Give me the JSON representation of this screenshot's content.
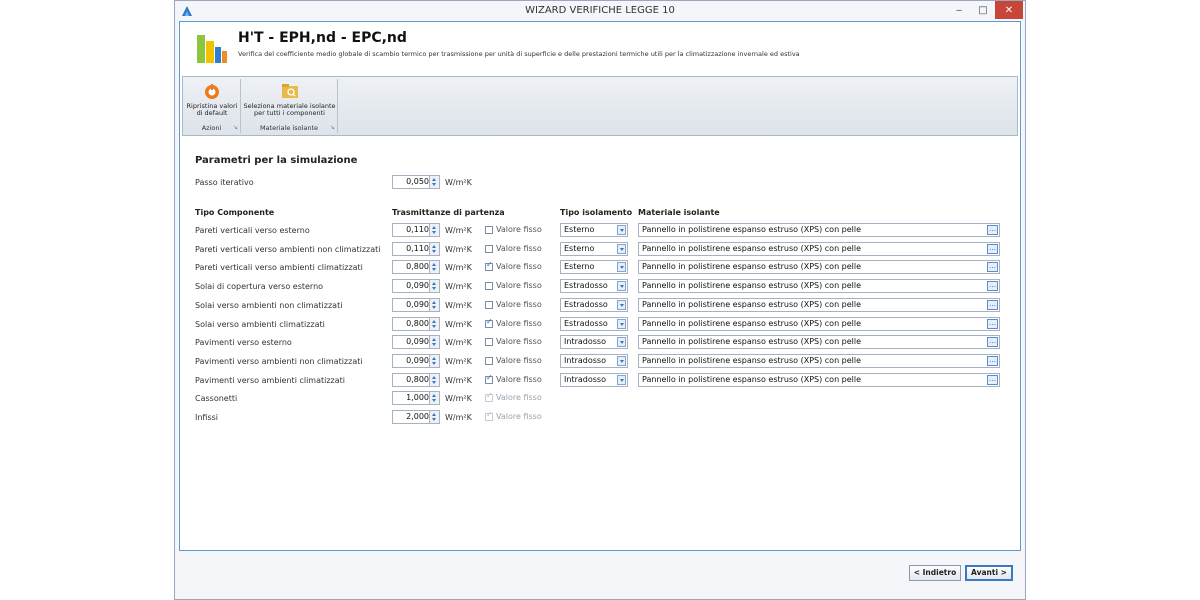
{
  "window": {
    "title": "WIZARD VERIFICHE LEGGE 10",
    "minimize": "‒",
    "maximize": "□",
    "close": "✕"
  },
  "header": {
    "title": "H'T - EPH,nd - EPC,nd",
    "subtitle": "Verifica del coefficiente medio globale di scambio termico per trasmissione per unità di superficie e delle prestazioni termiche utili per la climatizzazione invernale ed estiva"
  },
  "ribbon": {
    "groups": [
      {
        "label": "Azioni",
        "button_line1": "Ripristina valori",
        "button_line2": "di default",
        "icon": "reset-icon"
      },
      {
        "label": "Materiale isolante",
        "button_line1": "Seleziona materiale isolante",
        "button_line2": "per tutti i componenti",
        "icon": "folder-search-icon"
      }
    ]
  },
  "params": {
    "section_title": "Parametri per la simulazione",
    "step_label": "Passo iterativo",
    "step_value": "0,050",
    "unit": "W/m²K"
  },
  "columns": {
    "component": "Tipo Componente",
    "transmittance": "Trasmittanze di partenza",
    "insulation_type": "Tipo isolamento",
    "material": "Materiale isolante"
  },
  "fixed_label": "Valore fisso",
  "rows": [
    {
      "name": "Pareti verticali verso esterno",
      "value": "0,110",
      "fixed": false,
      "type": "Esterno",
      "material": "Pannello in polistirene espanso estruso (XPS) con pelle"
    },
    {
      "name": "Pareti verticali verso ambienti non climatizzati",
      "value": "0,110",
      "fixed": false,
      "type": "Esterno",
      "material": "Pannello in polistirene espanso estruso (XPS) con pelle"
    },
    {
      "name": "Pareti verticali verso ambienti climatizzati",
      "value": "0,800",
      "fixed": true,
      "type": "Esterno",
      "material": "Pannello in polistirene espanso estruso (XPS) con pelle"
    },
    {
      "name": "Solai di copertura verso esterno",
      "value": "0,090",
      "fixed": false,
      "type": "Estradosso",
      "material": "Pannello in polistirene espanso estruso (XPS) con pelle"
    },
    {
      "name": "Solai verso ambienti non climatizzati",
      "value": "0,090",
      "fixed": false,
      "type": "Estradosso",
      "material": "Pannello in polistirene espanso estruso (XPS) con pelle"
    },
    {
      "name": "Solai verso ambienti climatizzati",
      "value": "0,800",
      "fixed": true,
      "type": "Estradosso",
      "material": "Pannello in polistirene espanso estruso (XPS) con pelle"
    },
    {
      "name": "Pavimenti verso esterno",
      "value": "0,090",
      "fixed": false,
      "type": "Intradosso",
      "material": "Pannello in polistirene espanso estruso (XPS) con pelle"
    },
    {
      "name": "Pavimenti verso ambienti non climatizzati",
      "value": "0,090",
      "fixed": false,
      "type": "Intradosso",
      "material": "Pannello in polistirene espanso estruso (XPS) con pelle"
    },
    {
      "name": "Pavimenti verso ambienti climatizzati",
      "value": "0,800",
      "fixed": true,
      "type": "Intradosso",
      "material": "Pannello in polistirene espanso estruso (XPS) con pelle"
    },
    {
      "name": "Cassonetti",
      "value": "1,000",
      "fixed": true,
      "disabled": true
    },
    {
      "name": "Infissi",
      "value": "2,000",
      "fixed": true,
      "disabled": true
    }
  ],
  "footer": {
    "back": "< Indietro",
    "next": "Avanti >"
  },
  "colors": {
    "accent": "#3a78c2",
    "close": "#c7463a",
    "border": "#5b9bd5"
  }
}
